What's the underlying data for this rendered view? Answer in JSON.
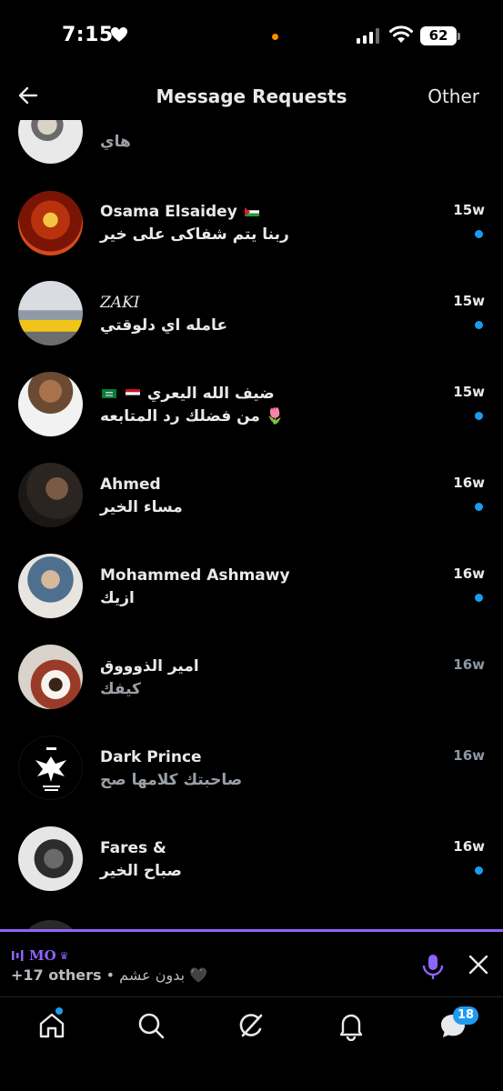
{
  "status_bar": {
    "time": "7:15",
    "battery": "62"
  },
  "header": {
    "title": "Message Requests",
    "other_label": "Other"
  },
  "conversations": [
    {
      "name": "",
      "preview": "هاي",
      "when": "15w",
      "unread": false
    },
    {
      "name": "Osama Elsaidey",
      "preview": "ربنا يتم شفاكى على خير",
      "when": "15w",
      "unread": true
    },
    {
      "name": "𝑍𝐴𝐾𝐼",
      "preview": "عامله اي دلوقتي",
      "when": "15w",
      "unread": true
    },
    {
      "name": "ضيف الله اليعري",
      "preview": "من فضلك رد المتابعه 🌷",
      "when": "15w",
      "unread": true
    },
    {
      "name": "Ahmed",
      "preview": "مساء الخير",
      "when": "16w",
      "unread": true
    },
    {
      "name": "Mohammed Ashmawy",
      "preview": "ازيك",
      "when": "16w",
      "unread": true
    },
    {
      "name": "امير الذوووق",
      "preview": "كيفك",
      "when": "16w",
      "unread": false
    },
    {
      "name": "Dark Prince",
      "preview": "صاحبتك كلامها صح",
      "when": "16w",
      "unread": false
    },
    {
      "name": "Fares &",
      "preview": "صباح الخير",
      "when": "16w",
      "unread": true
    }
  ],
  "space_bar": {
    "host": "MO",
    "others": "+17 others",
    "separator": "•",
    "title": "بدون عشم 🖤"
  },
  "bottom_nav": {
    "messages_badge": "18"
  },
  "colors": {
    "accent": "#1d9bf0",
    "space": "#8f63ff",
    "background": "#000000"
  },
  "icons": [
    "heart-icon",
    "signal-icon",
    "wifi-icon",
    "back-arrow-icon",
    "mic-icon",
    "close-icon",
    "home-icon",
    "search-icon",
    "grok-icon",
    "bell-icon",
    "messages-icon"
  ]
}
